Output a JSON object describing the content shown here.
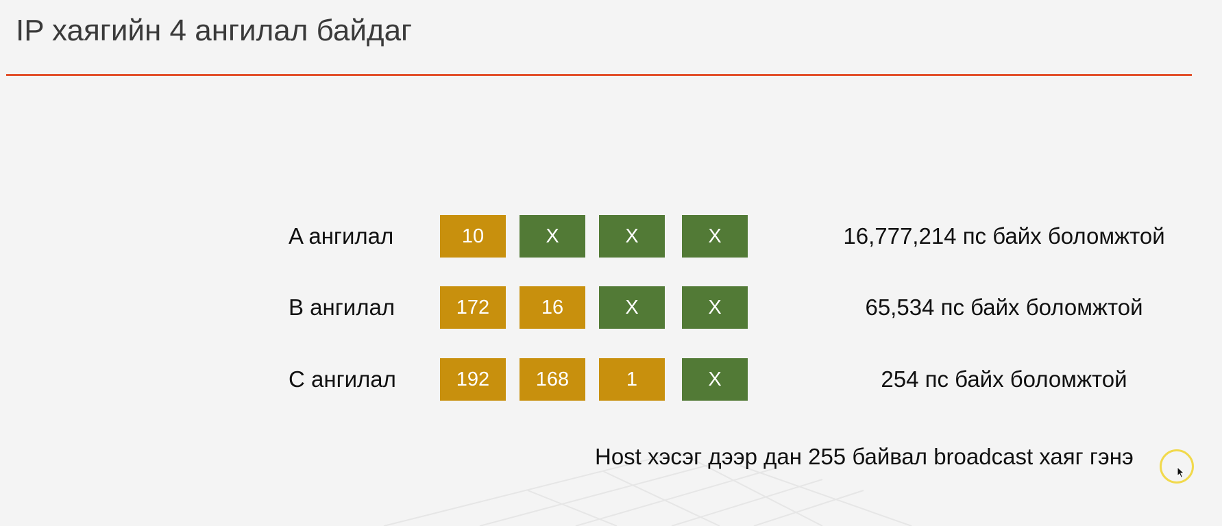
{
  "slide": {
    "title": "IP хаягийн 4 ангилал байдаг",
    "accent_color": "#e2512c"
  },
  "colors": {
    "network_octet": "#c8900d",
    "host_octet": "#527a36"
  },
  "classes": [
    {
      "label": "A ангилал",
      "octets": [
        {
          "value": "10",
          "kind": "network"
        },
        {
          "value": "X",
          "kind": "host"
        },
        {
          "value": "X",
          "kind": "host"
        },
        {
          "value": "X",
          "kind": "host"
        }
      ],
      "description": "16,777,214 пс байх боломжтой"
    },
    {
      "label": "B ангилал",
      "octets": [
        {
          "value": "172",
          "kind": "network"
        },
        {
          "value": "16",
          "kind": "network"
        },
        {
          "value": "X",
          "kind": "host"
        },
        {
          "value": "X",
          "kind": "host"
        }
      ],
      "description": "65,534 пс байх боломжтой"
    },
    {
      "label": "C ангилал",
      "octets": [
        {
          "value": "192",
          "kind": "network"
        },
        {
          "value": "168",
          "kind": "network"
        },
        {
          "value": "1",
          "kind": "network"
        },
        {
          "value": "X",
          "kind": "host"
        }
      ],
      "description": "254 пс байх боломжтой"
    }
  ],
  "footnote": "Host хэсэг дээр дан 255 байвал broadcast хаяг гэнэ",
  "pointer": {
    "icon": "mouse-pointer-icon",
    "highlight_color": "#f1d94c"
  }
}
